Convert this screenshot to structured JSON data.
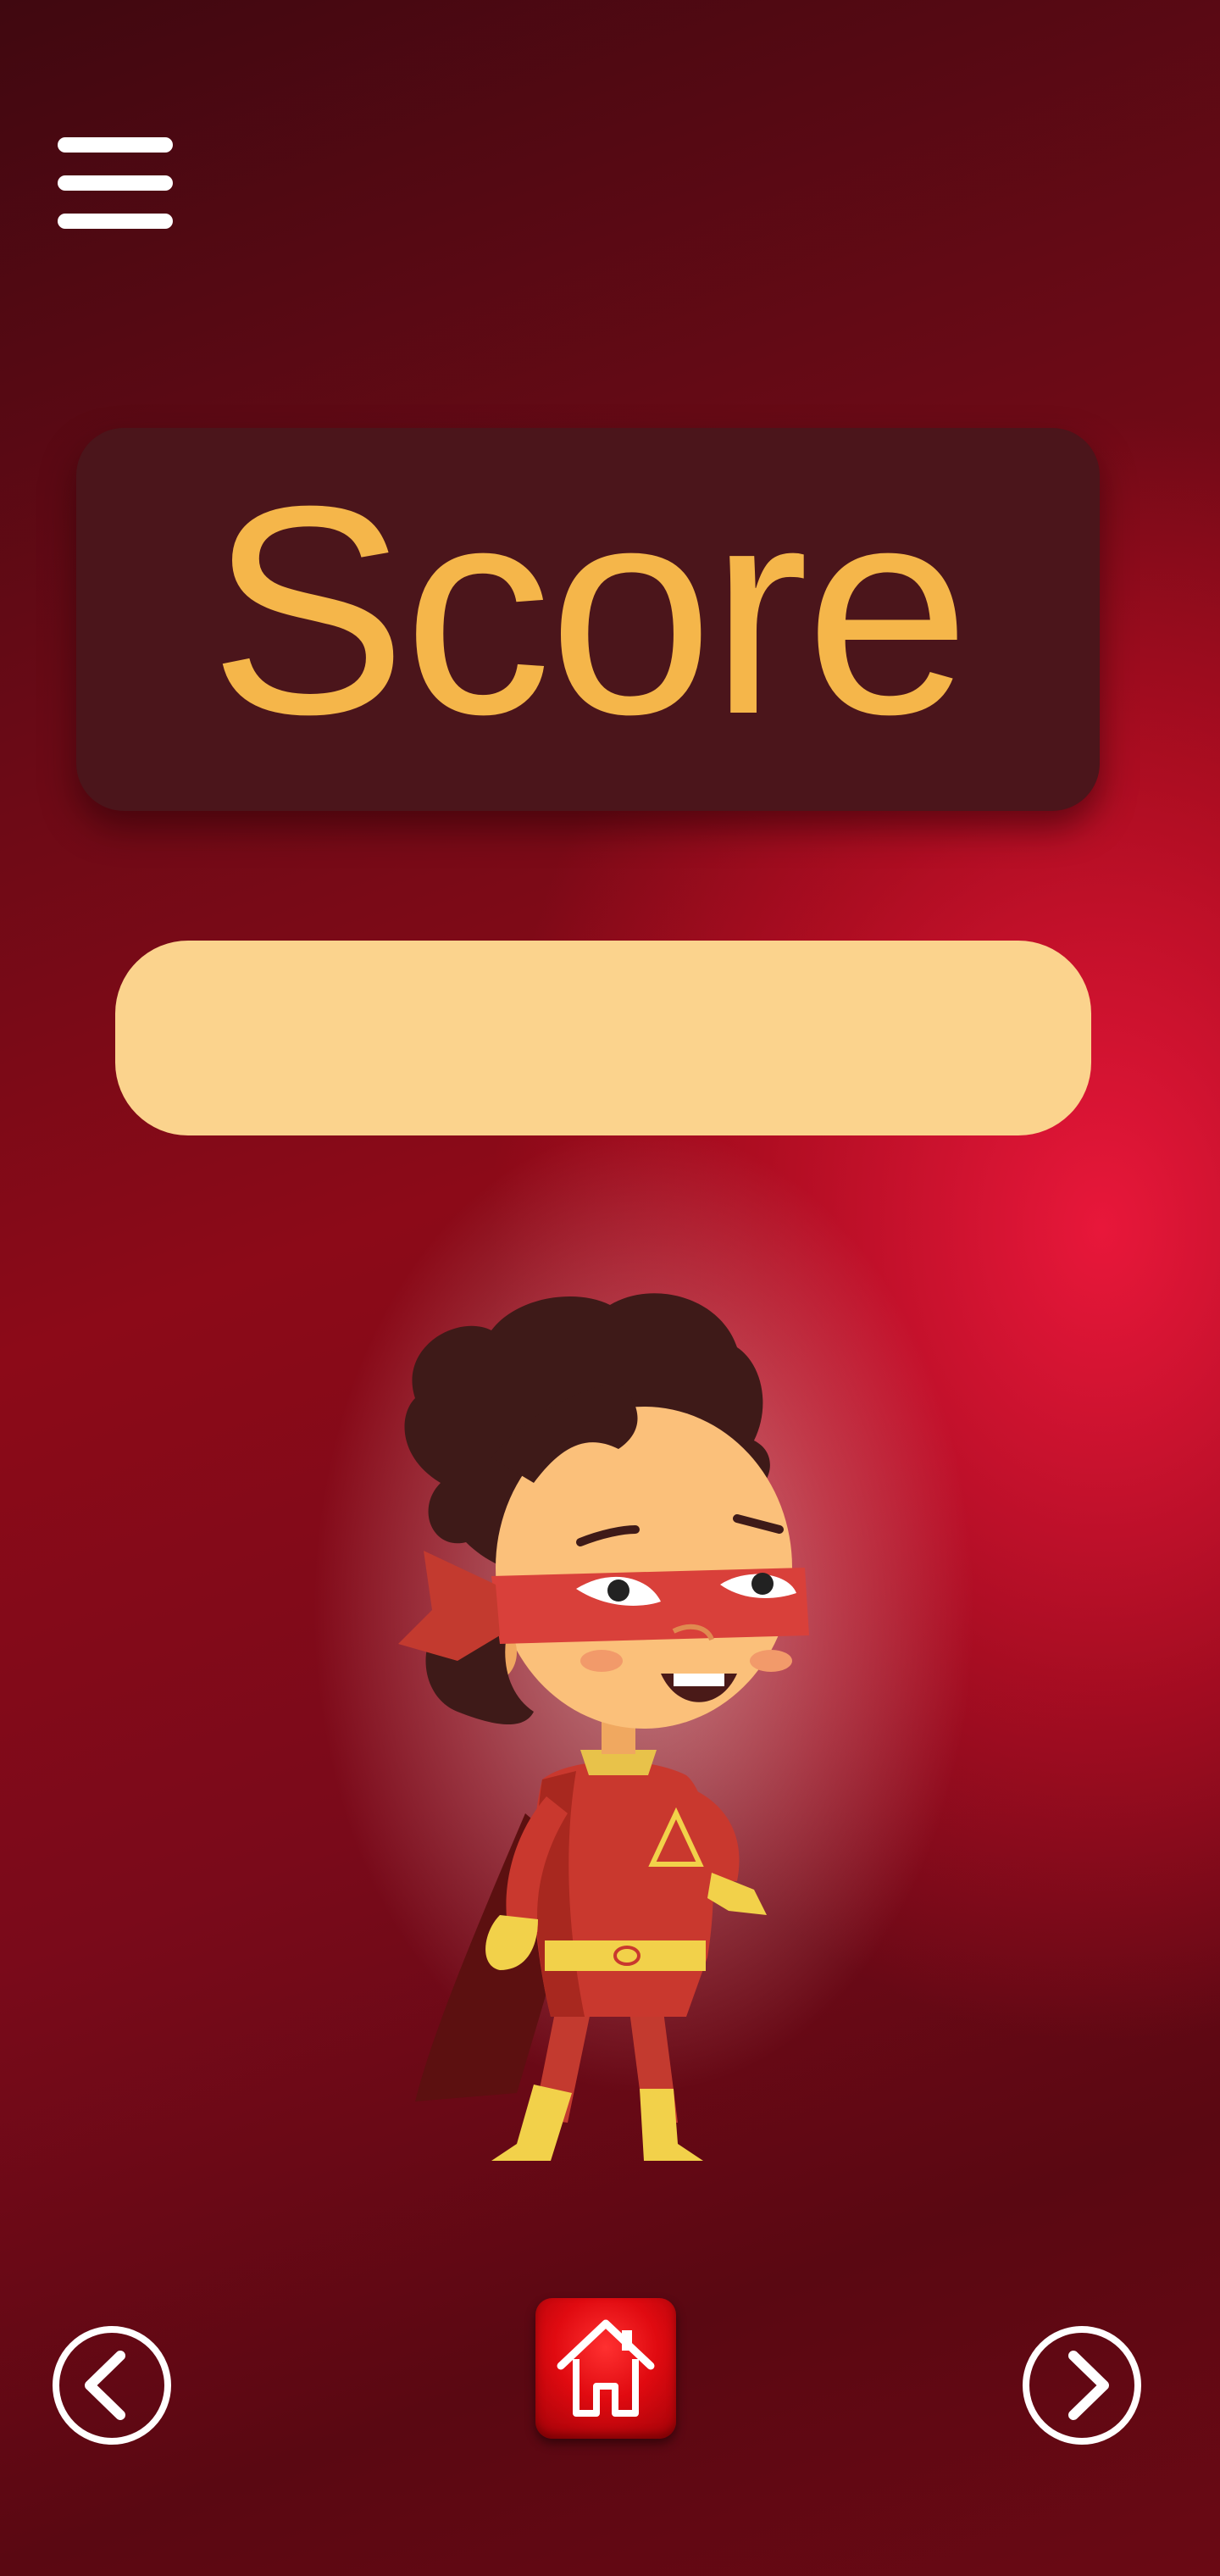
{
  "header": {
    "menu_icon": "hamburger-menu-icon"
  },
  "main": {
    "title": "Score",
    "answer_input": {
      "value": "",
      "placeholder": ""
    },
    "illustration": "superhero-kid-character"
  },
  "footer": {
    "prev_icon": "chevron-left-icon",
    "home_icon": "home-icon",
    "next_icon": "chevron-right-icon"
  },
  "colors": {
    "title_text": "#f5b64a",
    "title_box": "#4b151b",
    "input_bg": "#fbd38d",
    "home_button": "#e00a10"
  }
}
